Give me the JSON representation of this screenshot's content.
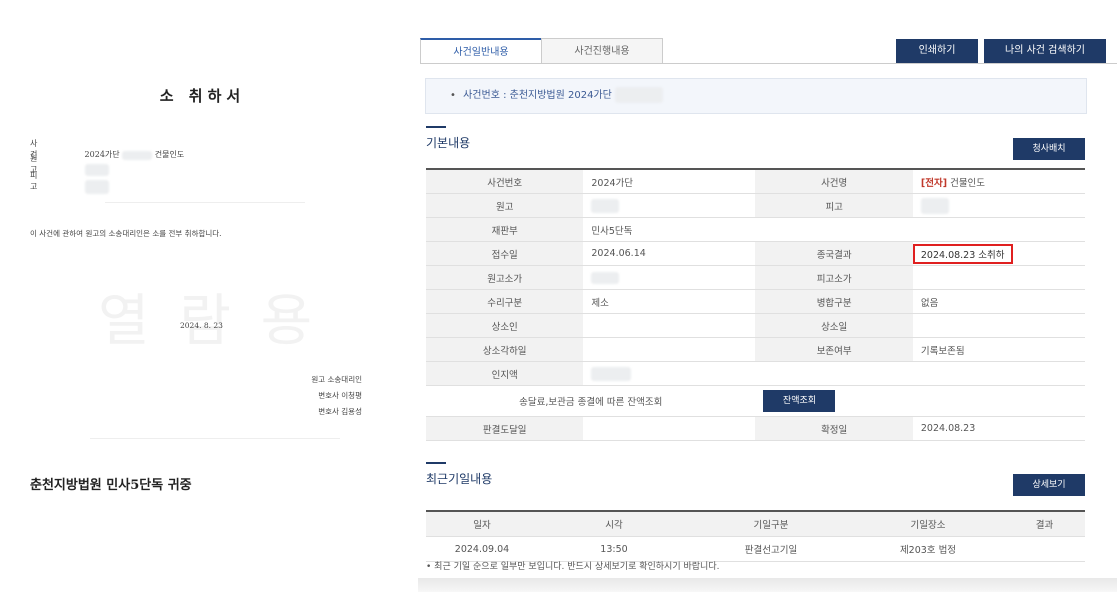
{
  "document": {
    "title": "소 취하서",
    "fields": [
      {
        "key": "사 건",
        "value": "2024가단",
        "suffix": "건물인도"
      },
      {
        "key": "원 고",
        "value": ""
      },
      {
        "key": "피 고",
        "value": ""
      }
    ],
    "body": "이 사건에 관하여 원고의 소송대리인은 소를 전부 취하합니다.",
    "watermark": "열 람 용",
    "date": "2024. 8. 23",
    "signatures": [
      "원고 소송대리인",
      "변호사 이청평",
      "변호사 김용성"
    ],
    "court": "춘천지방법원 민사5단독 귀중"
  },
  "tabs": [
    {
      "label": "사건일반내용",
      "active": true
    },
    {
      "label": "사건진행내용",
      "active": false
    }
  ],
  "top_buttons": {
    "print": "인쇄하기",
    "my_search": "나의 사건 검색하기"
  },
  "case_info": {
    "bullet": "•",
    "label": "사건번호 : 춘천지방법원 2024가단"
  },
  "basic": {
    "title": "기본내용",
    "button": "청사배치",
    "rows": [
      {
        "h1": "사건번호",
        "v1": "2024가단",
        "h2": "사건명",
        "v2_tag": "[전자]",
        "v2": "건물인도"
      },
      {
        "h1": "원고",
        "v1": "",
        "h2": "피고",
        "v2": ""
      },
      {
        "h1": "재판부",
        "v1": "민사5단독",
        "h2": "",
        "v2": ""
      },
      {
        "h1": "접수일",
        "v1": "2024.06.14",
        "h2": "종국결과",
        "v2": "2024.08.23 소취하"
      },
      {
        "h1": "원고소가",
        "v1": "",
        "h2": "피고소가",
        "v2": ""
      },
      {
        "h1": "수리구분",
        "v1": "제소",
        "h2": "병합구분",
        "v2": "없음"
      },
      {
        "h1": "상소인",
        "v1": "",
        "h2": "상소일",
        "v2": ""
      },
      {
        "h1": "상소각하일",
        "v1": "",
        "h2": "보존여부",
        "v2": "기록보존됨"
      },
      {
        "h1": "인지액",
        "v1": "",
        "h2": "",
        "v2": ""
      }
    ],
    "balance_label": "송달료,보관금 종결에 따른 잔액조회",
    "balance_button": "잔액조회",
    "last_row": {
      "h1": "판결도달일",
      "v1": "",
      "h2": "확정일",
      "v2": "2024.08.23"
    }
  },
  "recent": {
    "title": "최근기일내용",
    "button": "상세보기",
    "headers": [
      "일자",
      "시각",
      "기일구분",
      "기일장소",
      "결과"
    ],
    "rows": [
      [
        "2024.09.04",
        "13:50",
        "판결선고기일",
        "제203호 법정",
        ""
      ]
    ],
    "note": "• 최근 기일 순으로 일부만 보입니다. 반드시 상세보기로 확인하시기 바랍니다."
  }
}
